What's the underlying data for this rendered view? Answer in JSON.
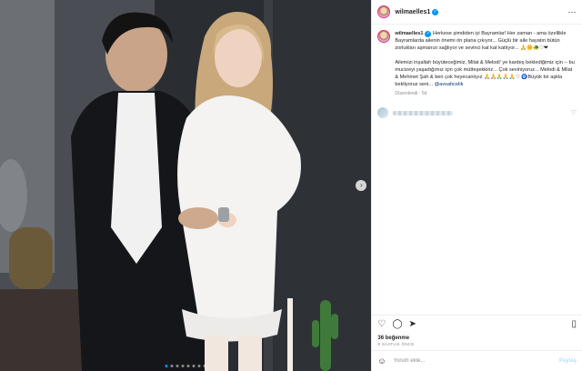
{
  "post": {
    "username": "wilmaelles1",
    "more_icon": "⋯",
    "caption_user": "wilmaelles1",
    "caption_text": "Herkese şimdiden iyi Bayramlar! Her zaman - ama özellikle Bayramlarda ailenin önemi ön plana çıkıyor... Güçlü bir aile hayatın bütün zorlukları aşmanızı sağlıyor ve sevinci kat kat katlıyor... 🙏🌼🐢♡❤",
    "caption_text2": "Ailemizi inşallah büyüteceğimiz, Milat & Melodi' ye kardeş beklediğimiz için -- bu mucizeyi yaşadığımız için çok mütteşekkiriz... Çok seviniyoruz... Melodi & Milat & Mehmet Şah & ben çok heyecanlıyız 🙏🙏🙏🙏🙏♡ 🧿Büyük bir aşkla bekliyoruz seni... ",
    "mention": "@avsahcelik",
    "meta": "Düzenlendi · 5d",
    "likes": "36 beğenme",
    "date": "8 SAATLİK ÖNCE",
    "comment_placeholder": "Yorum ekle...",
    "post_label": "Paylaş",
    "emoji_icon": "☺",
    "next_icon": "›"
  },
  "colors": {
    "accent": "#0095f6",
    "mention": "#00376b"
  }
}
